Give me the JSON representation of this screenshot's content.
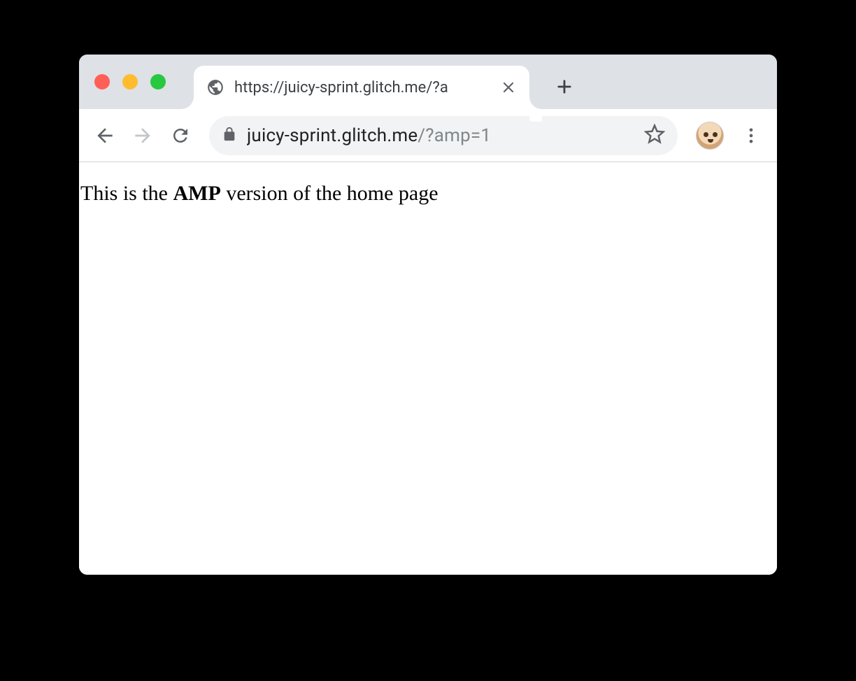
{
  "tab": {
    "title": "https://juicy-sprint.glitch.me/?a"
  },
  "url": {
    "host": "juicy-sprint.glitch.me",
    "path": "/?amp=1"
  },
  "page": {
    "text_prefix": "This is the ",
    "text_bold": "AMP",
    "text_suffix": " version of the home page"
  }
}
